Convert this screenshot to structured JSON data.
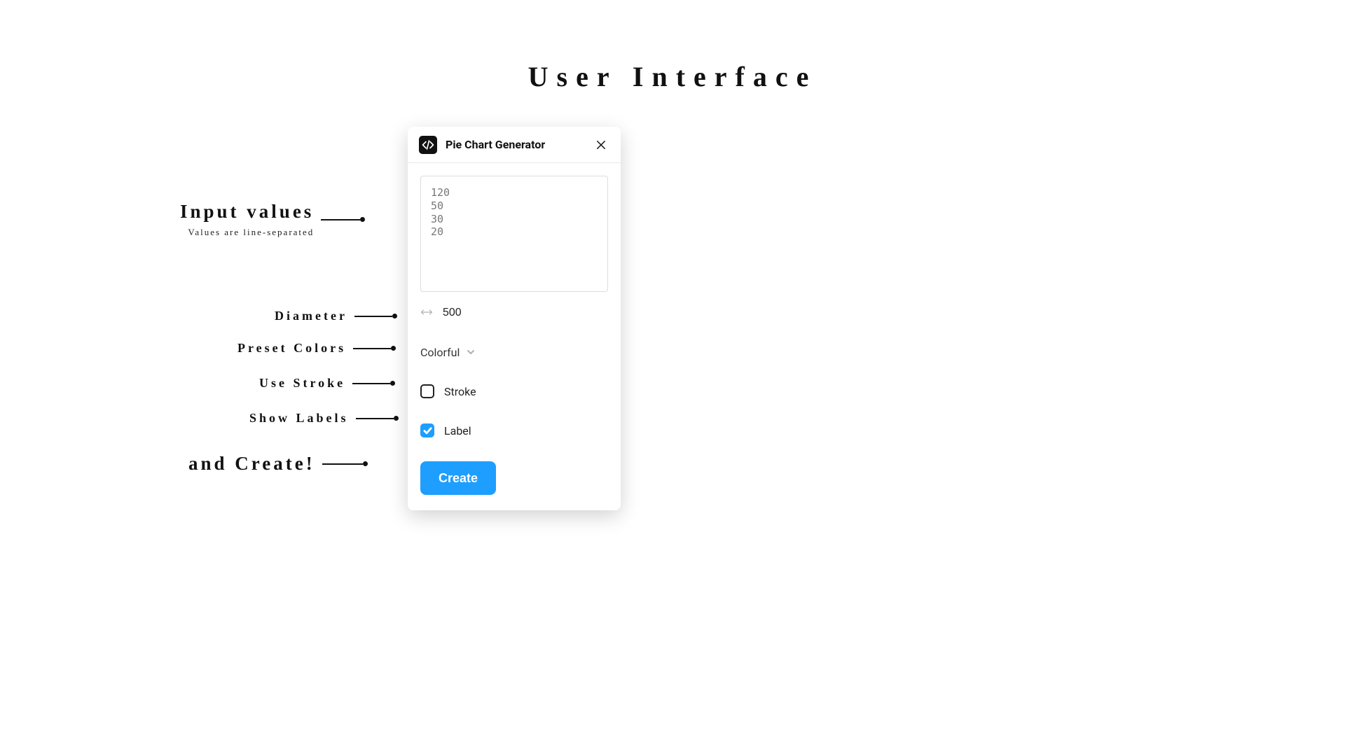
{
  "heading": "User Interface",
  "panel": {
    "title": "Pie Chart Generator",
    "values_text": "120\n50\n30\n20",
    "diameter_value": "500",
    "preset_value": "Colorful",
    "stroke_label": "Stroke",
    "stroke_checked": false,
    "label_label": "Label",
    "label_checked": true,
    "create_label": "Create"
  },
  "annotations": {
    "input_values": "Input values",
    "input_values_sub": "Values are line-separated",
    "diameter": "Diameter",
    "preset_colors": "Preset Colors",
    "use_stroke": "Use Stroke",
    "show_labels": "Show Labels",
    "and_create": "and Create!"
  }
}
